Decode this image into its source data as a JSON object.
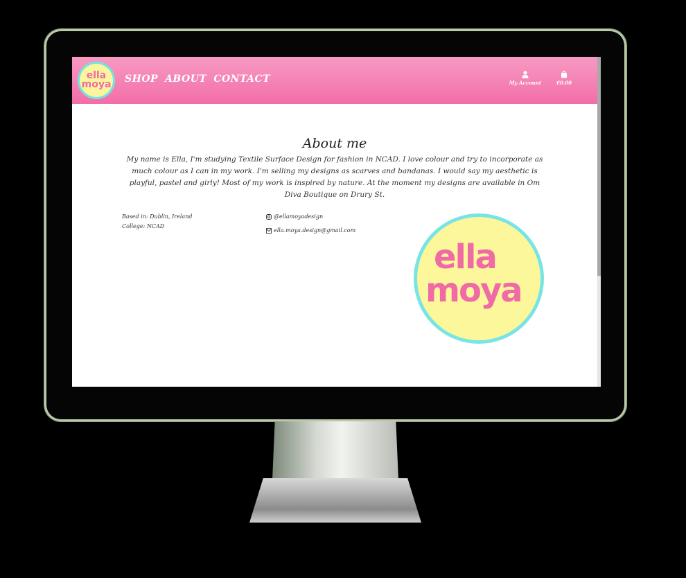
{
  "logo": {
    "line1": "ella",
    "line2": "moya"
  },
  "nav": {
    "links": [
      "SHOP",
      "ABOUT",
      "CONTACT"
    ],
    "account_label": "My Account",
    "cart_total": "€0.00"
  },
  "about": {
    "title": "About me",
    "text": "My name is Ella, I'm studying Textile Surface Design for fashion in NCAD. I love colour and try to incorporate as much colour as I can in my work. I'm selling my designs as scarves and bandanas. I would say my aesthetic is playful, pastel and girly! Most of my work is inspired by nature. At the moment my designs are available in Om Diva Boutique on Drury St.",
    "based_in": "Based in: Dublin, Ireland",
    "college": "College: NCAD",
    "instagram": "@ellamoyadesign",
    "email": "ella.moya.design@gmail.com"
  },
  "colors": {
    "nav_pink": "#f26ea8",
    "logo_yellow": "#fbf79a",
    "logo_ring": "#79e4e6",
    "logo_text": "#f06aa6"
  },
  "icons": [
    "user-icon",
    "shopping-bag-icon",
    "instagram-icon",
    "email-icon"
  ]
}
